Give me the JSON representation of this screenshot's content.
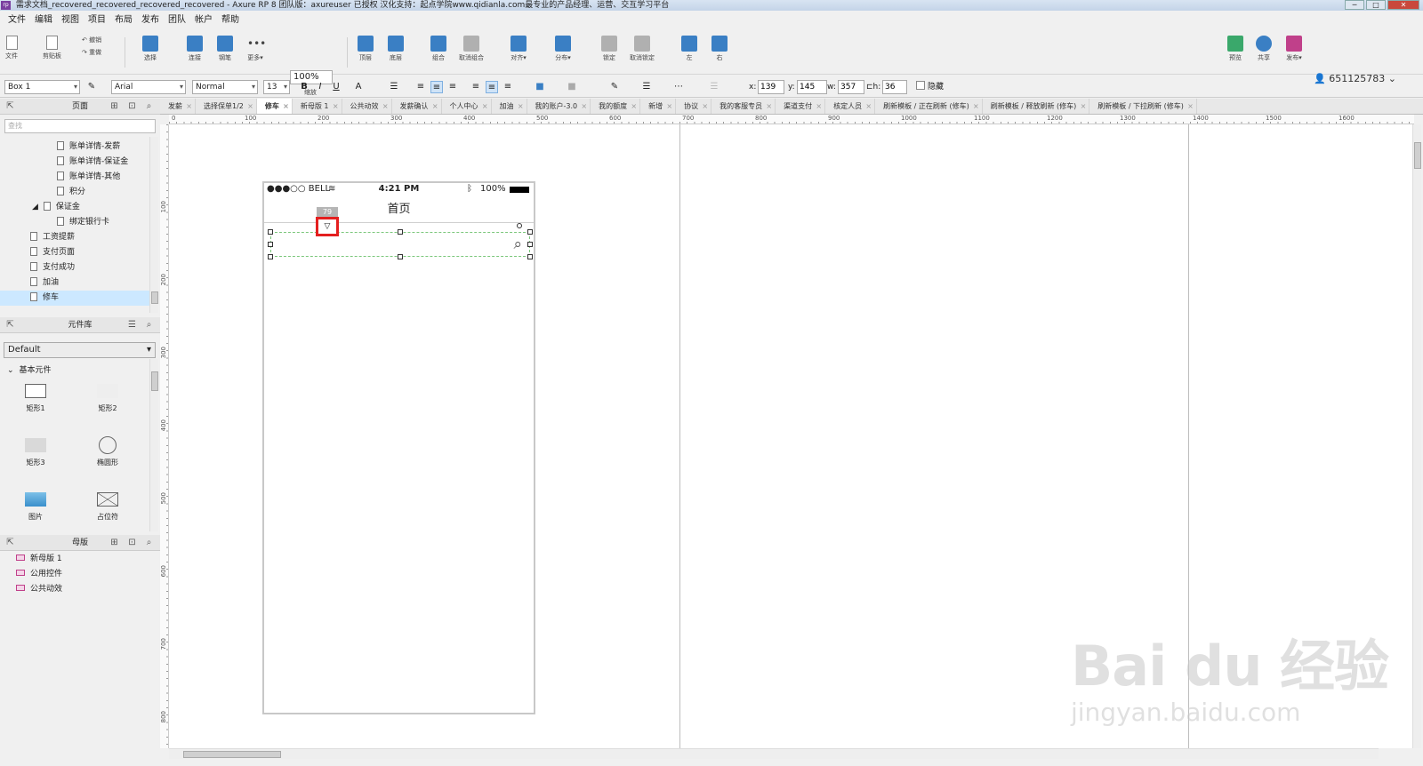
{
  "window": {
    "title": "需求文档_recovered_recovered_recovered_recovered - Axure RP 8 团队版：axureuser 已授权 汉化支持：起点学院www.qidianla.com最专业的产品经理、运营、交互学习平台",
    "app_icon": "rp",
    "controls": [
      "─",
      "□",
      "✕"
    ]
  },
  "menu": [
    "文件",
    "编辑",
    "视图",
    "项目",
    "布局",
    "发布",
    "团队",
    "帐户",
    "帮助"
  ],
  "toolbar": {
    "file": "文件",
    "clipboard": "剪贴板",
    "undo": "撤销",
    "redo": "重做",
    "select": "选择",
    "connect": "连接",
    "pen": "钢笔",
    "more": "更多▾",
    "zoom_value": "100%",
    "zoom_label": "缩放",
    "top": "顶层",
    "bottom": "底层",
    "group": "组合",
    "ungroup": "取消组合",
    "align": "对齐▾",
    "distribute": "分布▾",
    "lock": "锁定",
    "unlock": "取消锁定",
    "left": "左",
    "right": "右",
    "preview": "预览",
    "share": "共享",
    "publish": "发布▾",
    "user": "651125783"
  },
  "format": {
    "widget_name": "Box 1",
    "font": "Arial",
    "weight": "Normal",
    "size": "13",
    "x_label": "x:",
    "x": "139",
    "y_label": "y:",
    "y": "145",
    "w_label": "w:",
    "w": "357",
    "h_label": "h:",
    "h": "36",
    "hidden_label": "隐藏"
  },
  "pages_panel": {
    "title": "页面",
    "search_placeholder": "查找",
    "items": [
      "账单详情-发薪",
      "账单详情-保证金",
      "账单详情-其他",
      "积分",
      "保证金",
      "绑定银行卡",
      "工资提薪",
      "支付页面",
      "支付成功",
      "加油",
      "修车"
    ],
    "selected": "修车"
  },
  "library_panel": {
    "title": "元件库",
    "library": "Default",
    "section": "基本元件",
    "widgets": [
      "矩形1",
      "矩形2",
      "矩形3",
      "椭圆形",
      "图片",
      "占位符"
    ]
  },
  "masters_panel": {
    "title": "母版",
    "items": [
      "新母版 1",
      "公用控件",
      "公共动效"
    ]
  },
  "tabs": [
    "发薪",
    "选择保单1/2",
    "修车",
    "新母版 1",
    "公共动效",
    "发薪确认",
    "个人中心",
    "加油",
    "我的账户-3.0",
    "我的额度",
    "新增",
    "协议",
    "我的客服专员",
    "渠道支付",
    "核定人员",
    "刷新模板 / 正在刷新 (修车)",
    "刷新模板 / 释放刷新 (修车)",
    "刷新模板 / 下拉刷新 (修车)"
  ],
  "active_tab": "修车",
  "ruler": {
    "h": [
      "0",
      "100",
      "200",
      "300",
      "400",
      "500",
      "600",
      "700",
      "800",
      "900",
      "1000",
      "1100",
      "1200",
      "1300",
      "1400",
      "1500",
      "1600"
    ],
    "v": [
      "100",
      "200",
      "300",
      "400",
      "500",
      "600",
      "700",
      "800"
    ]
  },
  "phone": {
    "carrier": "●●●○○ BELL",
    "time": "4:21 PM",
    "battery": "100%",
    "nav_title": "首页",
    "badge": "79"
  },
  "watermark": {
    "logo": "Bai du 经验",
    "url": "jingyan.baidu.com"
  }
}
